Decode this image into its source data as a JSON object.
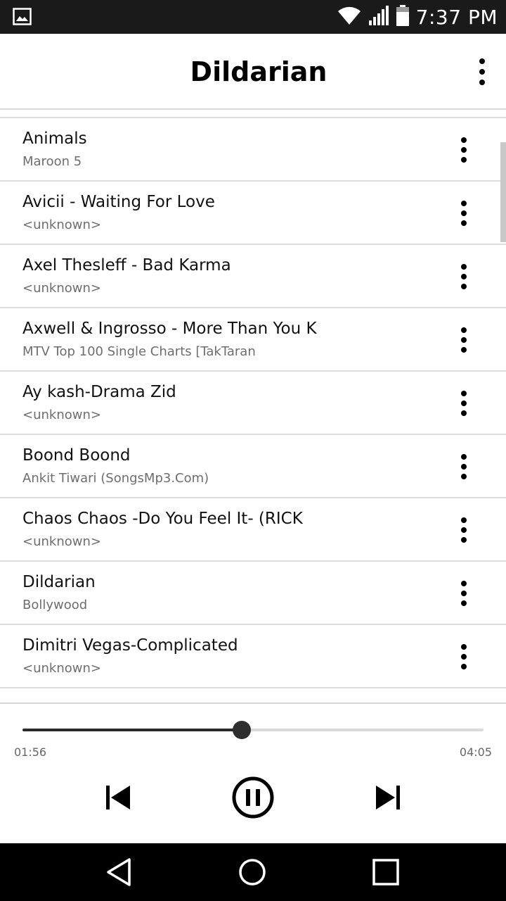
{
  "status_bar": {
    "time": "7:37 PM",
    "icons": [
      "image-notification-icon",
      "wifi-icon",
      "signal-icon",
      "battery-icon"
    ]
  },
  "app_bar": {
    "title": "Dildarian",
    "menu_icon": "more-vert-icon"
  },
  "songs": [
    {
      "title": "Animals",
      "subtitle": "Maroon 5"
    },
    {
      "title": "Avicii - Waiting For Love",
      "subtitle": "<unknown>"
    },
    {
      "title": "Axel Thesleff - Bad Karma",
      "subtitle": "<unknown>"
    },
    {
      "title": "Axwell & Ingrosso - More Than You K",
      "subtitle": "MTV Top 100 Single Charts [TakTaran"
    },
    {
      "title": "Ay kash-Drama Zid",
      "subtitle": "<unknown>"
    },
    {
      "title": "Boond Boond",
      "subtitle": "Ankit Tiwari (SongsMp3.Com)"
    },
    {
      "title": "Chaos Chaos -Do You Feel It- (RICK",
      "subtitle": "<unknown>"
    },
    {
      "title": "Dildarian",
      "subtitle": "Bollywood"
    },
    {
      "title": "Dimitri Vegas-Complicated",
      "subtitle": "<unknown>"
    }
  ],
  "player": {
    "elapsed": "01:56",
    "total": "04:05",
    "progress": 0.475,
    "controls": [
      "skip-previous-icon",
      "pause-icon",
      "skip-next-icon"
    ]
  },
  "nav_bar": {
    "icons": [
      "back-icon",
      "home-icon",
      "recents-icon"
    ]
  },
  "colors": {
    "status_bar": "#1a1a1a",
    "nav_bar": "#000000",
    "divider": "#dcdcdc",
    "subtitle_text": "#6e6e6e",
    "seek_fill": "#2a2a2a"
  }
}
